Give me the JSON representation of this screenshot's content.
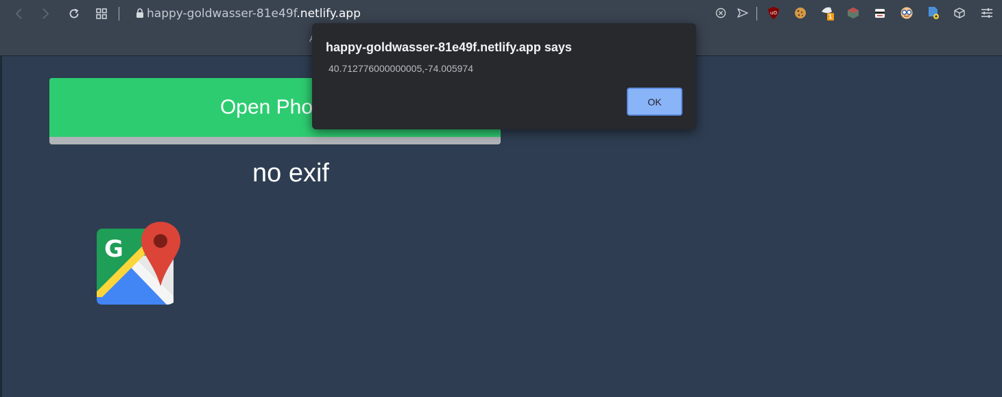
{
  "browser": {
    "url_prefix": "happy-goldwasser-81e49f",
    "url_domain": ".netlify.app",
    "tab_glyph": "A",
    "extension_badge": "1"
  },
  "page": {
    "open_photo_label": "Open Photo",
    "status_text": "no exif"
  },
  "dialog": {
    "title": "happy-goldwasser-81e49f.netlify.app says",
    "message": "40.712776000000005,-74.005974",
    "ok_label": "OK"
  },
  "colors": {
    "page_background": "#2e3d51",
    "chrome_background": "#3a4451",
    "button_green": "#2ecc71",
    "dialog_background": "#27292d",
    "ok_button": "#8ab4f8"
  },
  "icons": {
    "back": "back-arrow-icon",
    "forward": "forward-arrow-icon",
    "reload": "reload-icon",
    "speed_dial": "grid-icon",
    "lock": "lock-icon",
    "maps": "google-maps-icon"
  }
}
